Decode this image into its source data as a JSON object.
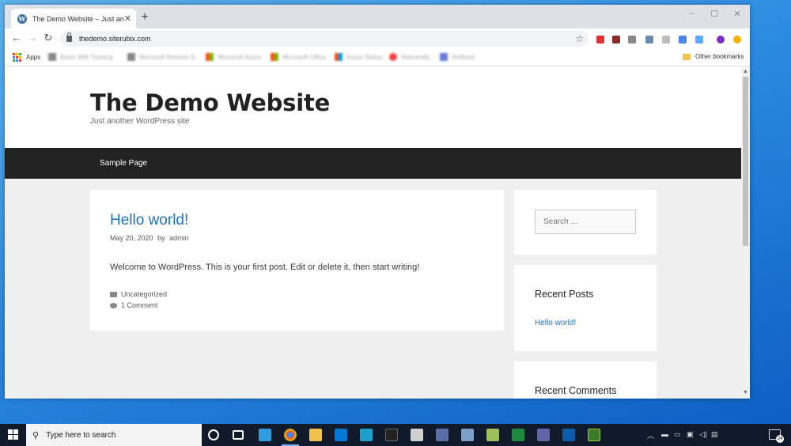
{
  "browser": {
    "tab_title": "The Demo Website – Just another",
    "tab_close": "✕",
    "new_tab": "+",
    "url": "thedemo.siterubix.com",
    "window_controls": {
      "minimize": "–",
      "maximize": "☐",
      "close": "✕"
    },
    "nav": {
      "back": "←",
      "forward": "→",
      "reload": "↻",
      "star": "☆"
    },
    "bookmarks": {
      "apps": "Apps",
      "items": [
        "Basic IBM Training",
        "Microsoft Remote D...",
        "Microsoft Azure",
        "Microsoft Office",
        "Azure Status",
        "Rebrandly",
        "Refback"
      ],
      "other": "Other bookmarks"
    }
  },
  "site": {
    "title": "The Demo Website",
    "tagline": "Just another WordPress site",
    "nav": [
      "Sample Page"
    ]
  },
  "post": {
    "title": "Hello world!",
    "date": "May 20, 2020",
    "by": "by",
    "author": "admin",
    "body": "Welcome to WordPress. This is your first post. Edit or delete it, then start writing!",
    "category": "Uncategorized",
    "comments": "1 Comment"
  },
  "sidebar": {
    "search_placeholder": "Search …",
    "recent_posts_title": "Recent Posts",
    "recent_posts": [
      "Hello world!"
    ],
    "recent_comments_title": "Recent Comments"
  },
  "taskbar": {
    "search_placeholder": "Type here to search",
    "notification_count": "24"
  },
  "colors": {
    "link": "#1e73be",
    "nav_bar": "#222222",
    "desktop": "#2b8be0",
    "taskbar": "#101a2a"
  }
}
